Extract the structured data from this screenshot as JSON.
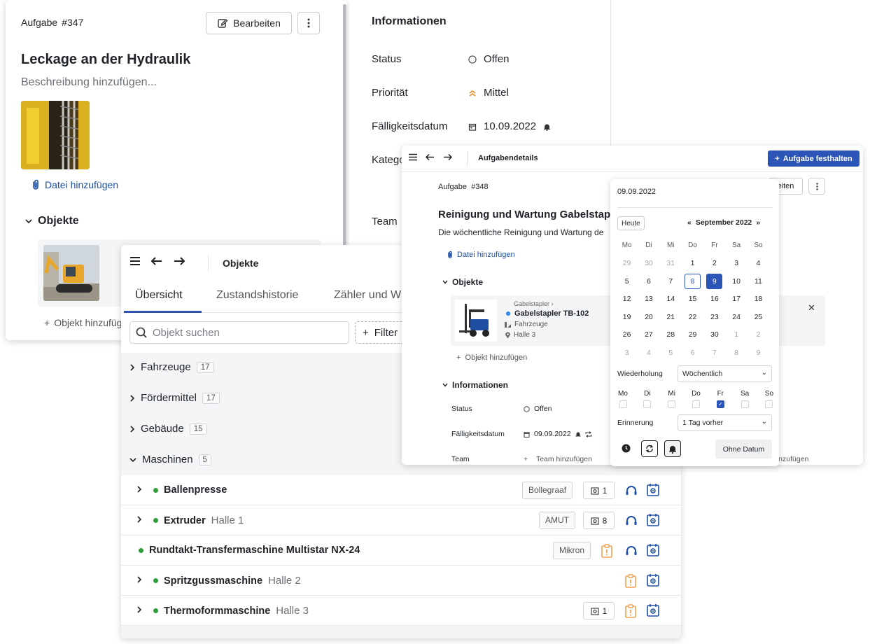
{
  "task_a": {
    "label": "Aufgabe",
    "number": "#347",
    "edit_label": "Bearbeiten",
    "title": "Leckage an der Hydraulik",
    "description_placeholder": "Beschreibung hinzufügen...",
    "add_file": "Datei hinzufügen",
    "objects_heading": "Objekte",
    "add_object": "Objekt hinzufügen"
  },
  "info_panel": {
    "heading": "Informationen",
    "rows": [
      {
        "label": "Status",
        "value": "Offen"
      },
      {
        "label": "Priorität",
        "value": "Mittel"
      },
      {
        "label": "Fälligkeitsdatum",
        "value": "10.09.2022"
      },
      {
        "label": "Katego"
      },
      {
        "label": "Team"
      }
    ]
  },
  "task_b": {
    "breadcrumb": "Aufgabendetails",
    "primary_button": "Aufgabe festhalten",
    "label": "Aufgabe",
    "number": "#348",
    "edit_label_partial": "eiten",
    "title": "Reinigung und Wartung Gabelstap",
    "description": "Die wöchentliche Reinigung und Wartung de",
    "add_file": "Datei hinzufügen",
    "objects_heading": "Objekte",
    "object": {
      "category": "Gabelstapler",
      "name": "Gabelstapler TB-102",
      "group": "Fahrzeuge",
      "location": "Halle 3"
    },
    "add_object": "Objekt hinzufügen",
    "info_heading": "Informationen",
    "status_label": "Status",
    "status_value": "Offen",
    "due_label": "Fälligkeitsdatum",
    "due_value": "09.09.2022",
    "team_label": "Team",
    "team_value": "Team hinzufügen",
    "right_add": "hinzufügen"
  },
  "datepicker": {
    "input_value": "09.09.2022",
    "today_button": "Heute",
    "month_label": "September 2022",
    "prev": "«",
    "next": "»",
    "weekdays": [
      "Mo",
      "Di",
      "Mi",
      "Do",
      "Fr",
      "Sa",
      "So"
    ],
    "days": [
      {
        "d": "29",
        "m": true
      },
      {
        "d": "30",
        "m": true
      },
      {
        "d": "31",
        "m": true
      },
      {
        "d": "1"
      },
      {
        "d": "2"
      },
      {
        "d": "3"
      },
      {
        "d": "4"
      },
      {
        "d": "5"
      },
      {
        "d": "6"
      },
      {
        "d": "7"
      },
      {
        "d": "8",
        "today": true
      },
      {
        "d": "9",
        "sel": true
      },
      {
        "d": "10"
      },
      {
        "d": "11"
      },
      {
        "d": "12"
      },
      {
        "d": "13"
      },
      {
        "d": "14"
      },
      {
        "d": "15"
      },
      {
        "d": "16"
      },
      {
        "d": "17"
      },
      {
        "d": "18"
      },
      {
        "d": "19"
      },
      {
        "d": "20"
      },
      {
        "d": "21"
      },
      {
        "d": "22"
      },
      {
        "d": "23"
      },
      {
        "d": "24"
      },
      {
        "d": "25"
      },
      {
        "d": "26"
      },
      {
        "d": "27"
      },
      {
        "d": "28"
      },
      {
        "d": "29"
      },
      {
        "d": "30"
      },
      {
        "d": "1",
        "m": true
      },
      {
        "d": "2",
        "m": true
      },
      {
        "d": "3",
        "m": true
      },
      {
        "d": "4",
        "m": true
      },
      {
        "d": "5",
        "m": true
      },
      {
        "d": "6",
        "m": true
      },
      {
        "d": "7",
        "m": true
      },
      {
        "d": "8",
        "m": true
      },
      {
        "d": "9",
        "m": true
      }
    ],
    "repeat_label": "Wiederholung",
    "repeat_value": "Wöchentlich",
    "repeat_days": [
      {
        "label": "Mo",
        "checked": false
      },
      {
        "label": "Di",
        "checked": false
      },
      {
        "label": "Mi",
        "checked": false
      },
      {
        "label": "Do",
        "checked": false
      },
      {
        "label": "Fr",
        "checked": true
      },
      {
        "label": "Sa",
        "checked": false
      },
      {
        "label": "So",
        "checked": false
      }
    ],
    "reminder_label": "Erinnerung",
    "reminder_value": "1 Tag vorher",
    "no_date_button": "Ohne Datum"
  },
  "objects_panel": {
    "breadcrumb": "Objekte",
    "tabs": [
      "Übersicht",
      "Zustandshistorie",
      "Zähler und W"
    ],
    "search_placeholder": "Objekt suchen",
    "filter_label": "Filter",
    "groups": [
      {
        "name": "Fahrzeuge",
        "count": "17"
      },
      {
        "name": "Fördermittel",
        "count": "17"
      },
      {
        "name": "Gebäude",
        "count": "15"
      },
      {
        "name": "Maschinen",
        "count": "5"
      }
    ],
    "machines": [
      {
        "name": "Ballenpresse",
        "location": "",
        "maker": "Bollegraaf",
        "counter": "1",
        "has_children": true,
        "warn": false
      },
      {
        "name": "Extruder",
        "location": "Halle 1",
        "maker": "AMUT",
        "counter": "8",
        "has_children": true,
        "warn": false
      },
      {
        "name": "Rundtakt-Transfermaschine Multistar NX-24",
        "location": "",
        "maker": "Mikron",
        "counter": "",
        "has_children": false,
        "warn": true
      },
      {
        "name": "Spritzgussmaschine",
        "location": "Halle 2",
        "maker": "",
        "counter": "",
        "has_children": true,
        "warn": true
      },
      {
        "name": "Thermoformmaschine",
        "location": "Halle 3",
        "maker": "",
        "counter": "1",
        "has_children": true,
        "warn": true
      }
    ]
  },
  "colors": {
    "accent": "#2c55b8",
    "status_green": "#2e9e3b",
    "priority_orange": "#f08a24",
    "warning_orange": "#f0a050"
  }
}
